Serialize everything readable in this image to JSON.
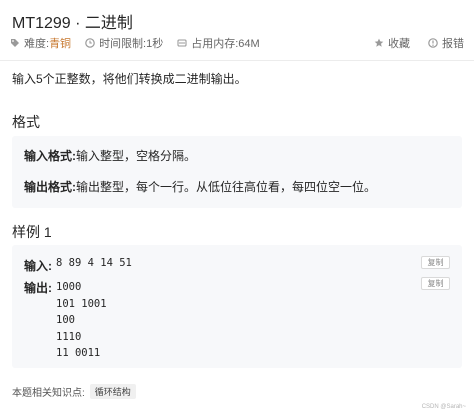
{
  "problem": {
    "title": "MT1299 · 二进制",
    "difficulty_label": "难度:",
    "difficulty_value": "青铜",
    "time_limit": "时间限制:1秒",
    "memory_limit": "占用内存:64M",
    "favorite_label": "收藏",
    "report_label": "报错",
    "description": "输入5个正整数，将他们转换成二进制输出。"
  },
  "format": {
    "heading": "格式",
    "input_label": "输入格式:",
    "input_text": "输入整型，空格分隔。",
    "output_label": "输出格式:",
    "output_text": "输出整型，每个一行。从低位往高位看，每四位空一位。"
  },
  "example": {
    "heading": "样例 1",
    "input_label": "输入:",
    "input_value": "8 89 4 14 51",
    "output_label": "输出:",
    "output_lines": [
      "1000",
      "101 1001",
      "100",
      "1110",
      "11 0011"
    ],
    "copy_label": "复制"
  },
  "knowledge": {
    "label": "本题相关知识点:",
    "tag": "循环结构"
  },
  "watermark": "CSDN @Sarah~",
  "colors": {
    "difficulty": "#c7772e",
    "box_background": "#f7f8fa"
  }
}
